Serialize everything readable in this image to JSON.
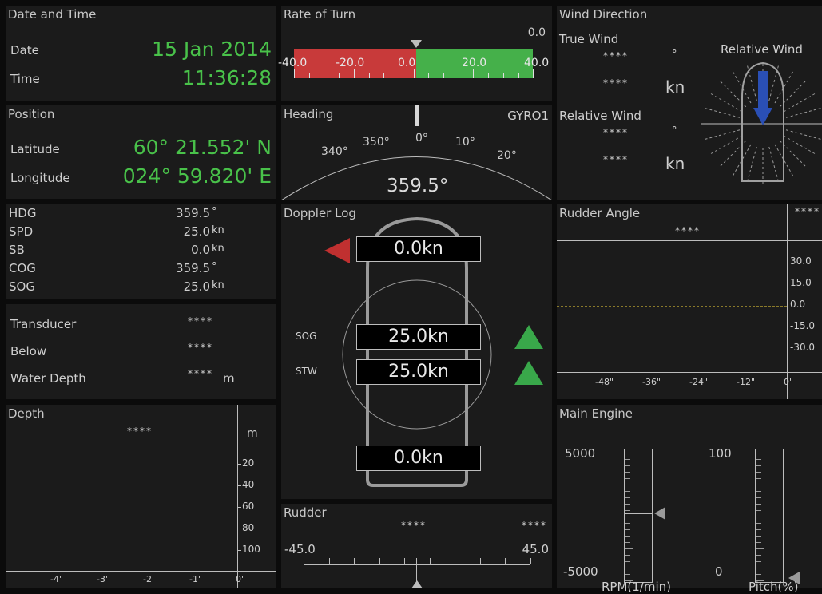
{
  "date_time": {
    "title": "Date and Time",
    "date_label": "Date",
    "date_value": "15 Jan 2014",
    "time_label": "Time",
    "time_value": "11:36:28"
  },
  "rot": {
    "title": "Rate of Turn",
    "value": "0.0",
    "scale": [
      "-40.0",
      "-20.0",
      "0.0",
      "20.0",
      "40.0"
    ]
  },
  "wind": {
    "title": "Wind Direction",
    "true_label": "True Wind",
    "true_dir": "****",
    "true_dir_unit": "°",
    "true_speed": "****",
    "true_speed_unit": "kn",
    "rel_label": "Relative Wind",
    "rel_dir": "****",
    "rel_dir_unit": "°",
    "rel_speed": "****",
    "rel_speed_unit": "kn",
    "rel_title": "Relative Wind"
  },
  "position": {
    "title": "Position",
    "lat_label": "Latitude",
    "lat_value": "60° 21.552' N",
    "lon_label": "Longitude",
    "lon_value": "024° 59.820' E"
  },
  "heading": {
    "title": "Heading",
    "source": "GYRO1",
    "value": "359.5°",
    "scale": [
      "340°",
      "350°",
      "0°",
      "10°",
      "20°"
    ]
  },
  "nav": {
    "rows": [
      {
        "label": "HDG",
        "value": "359.5",
        "unit": "°"
      },
      {
        "label": "SPD",
        "value": "25.0",
        "unit": "kn"
      },
      {
        "label": "SB",
        "value": "0.0",
        "unit": "kn"
      },
      {
        "label": "COG",
        "value": "359.5",
        "unit": "°"
      },
      {
        "label": "SOG",
        "value": "25.0",
        "unit": "kn"
      }
    ]
  },
  "depth_info": {
    "transducer_label": "Transducer",
    "transducer_value": "****",
    "below_label": "Below",
    "below_value": "****",
    "water_label": "Water Depth",
    "water_value": "****",
    "water_unit": "m"
  },
  "depth": {
    "title": "Depth",
    "value": "****",
    "unit": "m",
    "yticks": [
      "20",
      "40",
      "60",
      "80",
      "100"
    ],
    "xticks": [
      "-4'",
      "-3'",
      "-2'",
      "-1'",
      "0'"
    ]
  },
  "doppler": {
    "title": "Doppler Log",
    "fore": "0.0kn",
    "sog_label": "SOG",
    "sog": "25.0kn",
    "stw_label": "STW",
    "stw": "25.0kn",
    "aft": "0.0kn"
  },
  "rudder_angle": {
    "title": "Rudder Angle",
    "value": "****",
    "corner": "****",
    "yticks": [
      "30.0",
      "15.0",
      "0.0",
      "-15.0",
      "-30.0"
    ],
    "xticks": [
      "-48\"",
      "-36\"",
      "-24\"",
      "-12\"",
      "0\""
    ]
  },
  "rudder": {
    "title": "Rudder",
    "value_left": "****",
    "value_right": "****",
    "min": "-45.0",
    "max": "45.0"
  },
  "engine": {
    "title": "Main Engine",
    "rpm_max": "5000",
    "rpm_min": "-5000",
    "rpm_label": "RPM(1/min)",
    "pitch_max": "100",
    "pitch_min": "0",
    "pitch_label": "Pitch(%)"
  }
}
